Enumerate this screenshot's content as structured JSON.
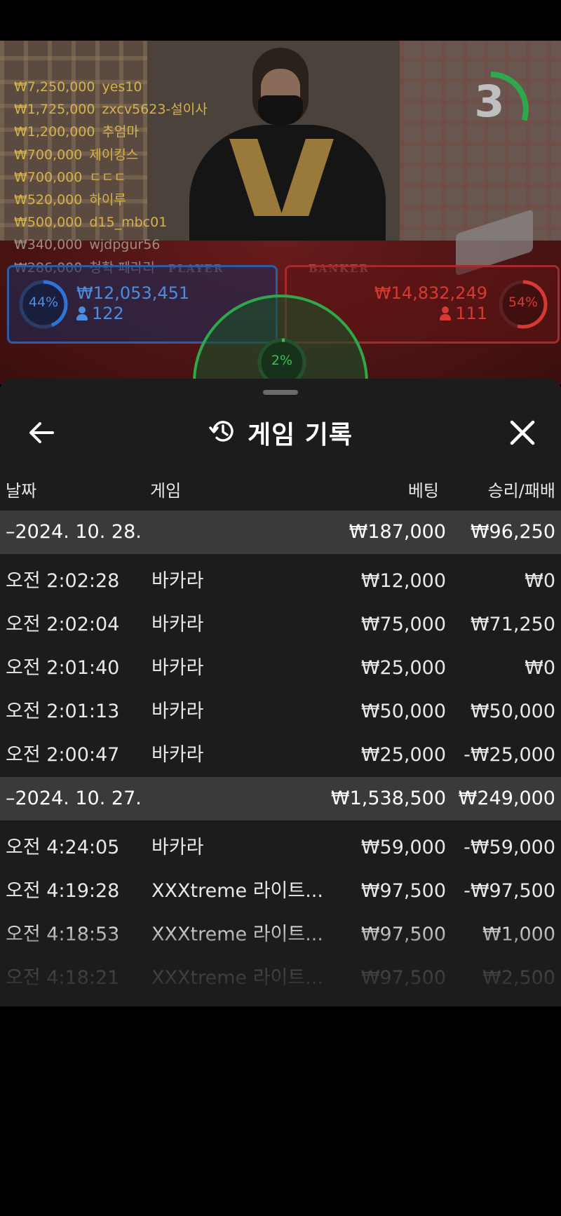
{
  "leaderboard": [
    {
      "amount": "₩7,250,000",
      "name": "yes10"
    },
    {
      "amount": "₩1,725,000",
      "name": "zxcv5623-설이사"
    },
    {
      "amount": "₩1,200,000",
      "name": "추엄마"
    },
    {
      "amount": "₩700,000",
      "name": "제이킹스"
    },
    {
      "amount": "₩700,000",
      "name": "ㄷㄷㄷ"
    },
    {
      "amount": "₩520,000",
      "name": "하이루"
    },
    {
      "amount": "₩500,000",
      "name": "d15_mbc01"
    },
    {
      "amount": "₩340,000",
      "name": "wjdpgur56"
    },
    {
      "amount": "₩286,000",
      "name": "청학 페라리"
    }
  ],
  "countdown": {
    "value": "3",
    "progress": 0.3
  },
  "table_labels": {
    "player": "PLAYER",
    "banker": "BANKER"
  },
  "player": {
    "percent_text": "44%",
    "percent": 44,
    "amount": "₩12,053,451",
    "count": "122"
  },
  "banker": {
    "percent_text": "54%",
    "percent": 54,
    "amount": "₩14,832,249",
    "count": "111"
  },
  "tie": {
    "percent_text": "2%",
    "percent": 2
  },
  "colors": {
    "player": "#2f73d6",
    "banker": "#d63a32",
    "tie": "#3bbf4f",
    "gold": "#d6b24a",
    "sheet_bg": "#1c1c1c",
    "group_bg": "#3a3a3a"
  },
  "sheet": {
    "title": "게임 기록",
    "back_icon": "arrow-left-icon",
    "history_icon": "history-icon",
    "close_icon": "close-icon",
    "columns": {
      "date": "날짜",
      "game": "게임",
      "bet": "베팅",
      "result": "승리/패배"
    },
    "groups": [
      {
        "date": "–2024. 10. 28.",
        "bet": "₩187,000",
        "result": "₩96,250",
        "rows": [
          {
            "time": "오전 2:02:28",
            "game": "바카라",
            "bet": "₩12,000",
            "result": "₩0"
          },
          {
            "time": "오전 2:02:04",
            "game": "바카라",
            "bet": "₩75,000",
            "result": "₩71,250"
          },
          {
            "time": "오전 2:01:40",
            "game": "바카라",
            "bet": "₩25,000",
            "result": "₩0"
          },
          {
            "time": "오전 2:01:13",
            "game": "바카라",
            "bet": "₩50,000",
            "result": "₩50,000"
          },
          {
            "time": "오전 2:00:47",
            "game": "바카라",
            "bet": "₩25,000",
            "result": "-₩25,000"
          }
        ]
      },
      {
        "date": "–2024. 10. 27.",
        "bet": "₩1,538,500",
        "result": "₩249,000",
        "rows": [
          {
            "time": "오전 4:24:05",
            "game": "바카라",
            "bet": "₩59,000",
            "result": "-₩59,000"
          },
          {
            "time": "오전 4:19:28",
            "game": "XXXtreme 라이트...",
            "bet": "₩97,500",
            "result": "-₩97,500"
          },
          {
            "time": "오전 4:18:53",
            "game": "XXXtreme 라이트...",
            "bet": "₩97,500",
            "result": "₩1,000"
          },
          {
            "time": "오전 4:18:21",
            "game": "XXXtreme 라이트...",
            "bet": "₩97,500",
            "result": "₩2,500"
          }
        ]
      }
    ]
  }
}
